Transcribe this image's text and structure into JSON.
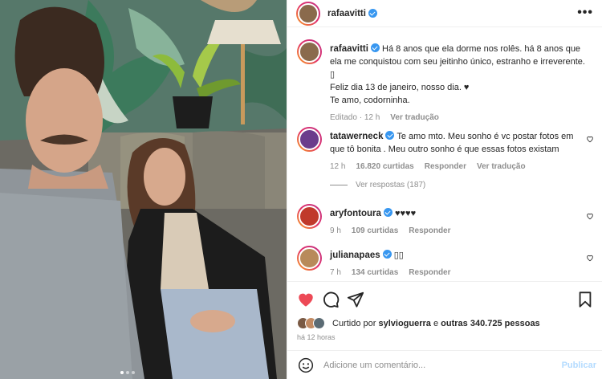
{
  "post": {
    "author": "rafaavitti",
    "more_label": "•••"
  },
  "caption": {
    "author": "rafaavitti",
    "line1": "Há 8 anos que ela dorme nos rolês. há 8 anos que ela me conquistou com seu jeitinho único, estranho e irreverente.",
    "line2": "▯",
    "line3": "Feliz dia 13 de janeiro, nosso dia. ♥",
    "line4": "Te amo, codorninha.",
    "edited": "Editado",
    "time": "12 h",
    "translate": "Ver tradução"
  },
  "comments": [
    {
      "user": "tatawerneck",
      "text": "Te amo mto. Meu sonho é vc postar fotos em que tô bonita . Meu outro sonho é que essas fotos existam",
      "time": "12 h",
      "likes": "16.820 curtidas",
      "reply": "Responder",
      "translate": "Ver tradução"
    },
    {
      "user": "aryfontoura",
      "text": "♥♥♥♥",
      "time": "9 h",
      "likes": "109 curtidas",
      "reply": "Responder"
    },
    {
      "user": "julianapaes",
      "text": "▯▯",
      "time": "7 h",
      "likes": "134 curtidas",
      "reply": "Responder"
    }
  ],
  "view_replies": "Ver respostas (187)",
  "likes": {
    "prefix": "Curtido por",
    "user": "sylvioguerra",
    "middle": "e",
    "others": "outras 340.725 pessoas"
  },
  "posted_ago": "há 12 horas",
  "add_comment": {
    "placeholder": "Adicione um comentário...",
    "publish": "Publicar"
  },
  "icons": {
    "like": "heart-icon",
    "comment": "comment-icon",
    "share": "send-icon",
    "save": "bookmark-icon",
    "emoji": "emoji-icon"
  },
  "colors": {
    "like_red": "#ed4956",
    "link_blue": "#3897f0",
    "muted": "#8e8e8e"
  }
}
